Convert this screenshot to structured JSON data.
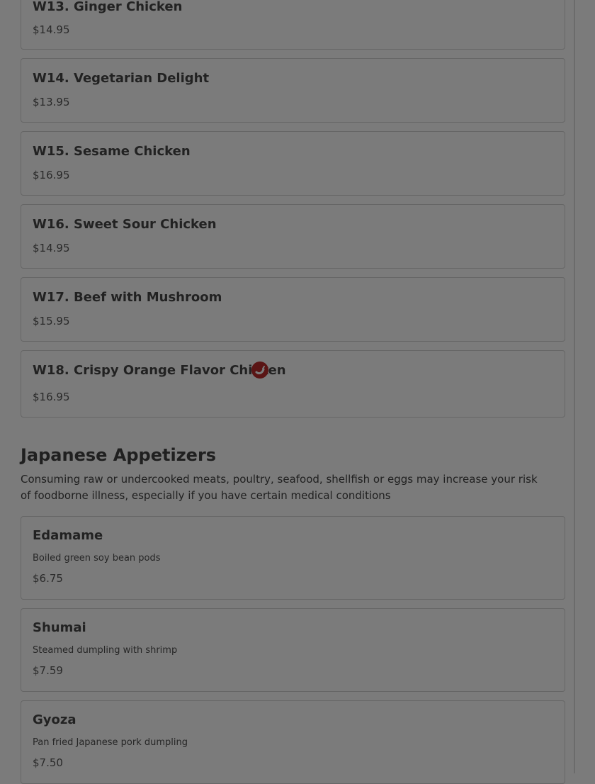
{
  "wok_items": [
    {
      "name": "W13. Ginger Chicken",
      "price": "$14.95"
    },
    {
      "name": "W14. Vegetarian Delight",
      "price": "$13.95"
    },
    {
      "name": "W15. Sesame Chicken",
      "price": "$16.95"
    },
    {
      "name": "W16. Sweet Sour Chicken",
      "price": "$14.95"
    },
    {
      "name": "W17. Beef with Mushroom",
      "price": "$15.95"
    },
    {
      "name": "W18. Crispy Orange Flavor Chicken",
      "price": "$16.95",
      "icon": "spicy-pepper-icon"
    }
  ],
  "section": {
    "title": "Japanese Appetizers",
    "note": "Consuming raw or undercooked meats, poultry, seafood, shellfish or eggs may increase your risk of foodborne illness, especially if you have certain medical conditions"
  },
  "appetizers": [
    {
      "name": "Edamame",
      "description": "Boiled green soy bean pods",
      "price": "$6.75"
    },
    {
      "name": "Shumai",
      "description": "Steamed dumpling with shrimp",
      "price": "$7.59"
    },
    {
      "name": "Gyoza",
      "description": "Pan fried Japanese pork dumpling",
      "price": "$7.50"
    }
  ],
  "colors": {
    "overlay_background": "#7b7b7b",
    "spicy_icon": "#5a1515"
  }
}
